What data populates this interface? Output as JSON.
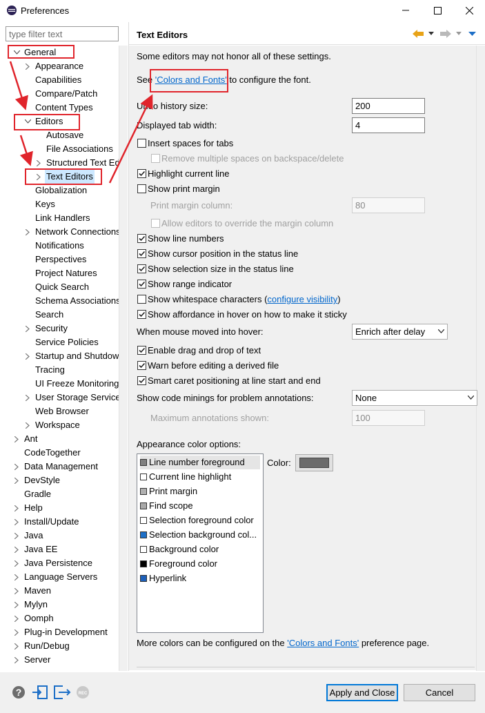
{
  "window": {
    "title": "Preferences"
  },
  "filter": {
    "placeholder": "type filter text"
  },
  "tree": {
    "items": [
      {
        "label": "General",
        "level": 0,
        "chevron": "down"
      },
      {
        "label": "Appearance",
        "level": 1,
        "chevron": "right"
      },
      {
        "label": "Capabilities",
        "level": 1,
        "chevron": ""
      },
      {
        "label": "Compare/Patch",
        "level": 1,
        "chevron": ""
      },
      {
        "label": "Content Types",
        "level": 1,
        "chevron": ""
      },
      {
        "label": "Editors",
        "level": 1,
        "chevron": "down"
      },
      {
        "label": "Autosave",
        "level": 2,
        "chevron": ""
      },
      {
        "label": "File Associations",
        "level": 2,
        "chevron": ""
      },
      {
        "label": "Structured Text Ed",
        "level": 2,
        "chevron": "right"
      },
      {
        "label": "Text Editors",
        "level": 2,
        "chevron": "right",
        "selected": true
      },
      {
        "label": "Globalization",
        "level": 1,
        "chevron": ""
      },
      {
        "label": "Keys",
        "level": 1,
        "chevron": ""
      },
      {
        "label": "Link Handlers",
        "level": 1,
        "chevron": ""
      },
      {
        "label": "Network Connections",
        "level": 1,
        "chevron": "right"
      },
      {
        "label": "Notifications",
        "level": 1,
        "chevron": ""
      },
      {
        "label": "Perspectives",
        "level": 1,
        "chevron": ""
      },
      {
        "label": "Project Natures",
        "level": 1,
        "chevron": ""
      },
      {
        "label": "Quick Search",
        "level": 1,
        "chevron": ""
      },
      {
        "label": "Schema Associations",
        "level": 1,
        "chevron": ""
      },
      {
        "label": "Search",
        "level": 1,
        "chevron": ""
      },
      {
        "label": "Security",
        "level": 1,
        "chevron": "right"
      },
      {
        "label": "Service Policies",
        "level": 1,
        "chevron": ""
      },
      {
        "label": "Startup and Shutdown",
        "level": 1,
        "chevron": "right"
      },
      {
        "label": "Tracing",
        "level": 1,
        "chevron": ""
      },
      {
        "label": "UI Freeze Monitoring",
        "level": 1,
        "chevron": ""
      },
      {
        "label": "User Storage Service",
        "level": 1,
        "chevron": "right"
      },
      {
        "label": "Web Browser",
        "level": 1,
        "chevron": ""
      },
      {
        "label": "Workspace",
        "level": 1,
        "chevron": "right"
      },
      {
        "label": "Ant",
        "level": 0,
        "chevron": "right"
      },
      {
        "label": "CodeTogether",
        "level": 0,
        "chevron": ""
      },
      {
        "label": "Data Management",
        "level": 0,
        "chevron": "right"
      },
      {
        "label": "DevStyle",
        "level": 0,
        "chevron": "right"
      },
      {
        "label": "Gradle",
        "level": 0,
        "chevron": ""
      },
      {
        "label": "Help",
        "level": 0,
        "chevron": "right"
      },
      {
        "label": "Install/Update",
        "level": 0,
        "chevron": "right"
      },
      {
        "label": "Java",
        "level": 0,
        "chevron": "right"
      },
      {
        "label": "Java EE",
        "level": 0,
        "chevron": "right"
      },
      {
        "label": "Java Persistence",
        "level": 0,
        "chevron": "right"
      },
      {
        "label": "Language Servers",
        "level": 0,
        "chevron": "right"
      },
      {
        "label": "Maven",
        "level": 0,
        "chevron": "right"
      },
      {
        "label": "Mylyn",
        "level": 0,
        "chevron": "right"
      },
      {
        "label": "Oomph",
        "level": 0,
        "chevron": "right"
      },
      {
        "label": "Plug-in Development",
        "level": 0,
        "chevron": "right"
      },
      {
        "label": "Run/Debug",
        "level": 0,
        "chevron": "right"
      },
      {
        "label": "Server",
        "level": 0,
        "chevron": "right"
      }
    ]
  },
  "page": {
    "title": "Text Editors",
    "intro": "Some editors may not honor all of these settings.",
    "see_prefix": "See ",
    "colors_fonts_link": "'Colors and Fonts'",
    "see_suffix": " to configure the font.",
    "undo_label": "Undo history size:",
    "undo_value": "200",
    "tab_width_label": "Displayed tab width:",
    "tab_width_value": "4",
    "insert_spaces": {
      "label": "Insert spaces for tabs",
      "checked": false
    },
    "remove_spaces": {
      "label": "Remove multiple spaces on backspace/delete",
      "checked": false,
      "disabled": true
    },
    "highlight_line": {
      "label": "Highlight current line",
      "checked": true
    },
    "show_print_margin": {
      "label": "Show print margin",
      "checked": false
    },
    "print_margin_col_label": "Print margin column:",
    "print_margin_col_value": "80",
    "allow_override": {
      "label": "Allow editors to override the margin column",
      "checked": false,
      "disabled": true
    },
    "show_line_numbers": {
      "label": "Show line numbers",
      "checked": true
    },
    "show_cursor_pos": {
      "label": "Show cursor position in the status line",
      "checked": true
    },
    "show_selection_size": {
      "label": "Show selection size in the status line",
      "checked": true
    },
    "show_range": {
      "label": "Show range indicator",
      "checked": true
    },
    "show_whitespace": {
      "label": "Show whitespace characters (",
      "link": "configure visibility",
      "suffix": ")",
      "checked": false
    },
    "show_affordance": {
      "label": "Show affordance in hover on how to make it sticky",
      "checked": true
    },
    "hover_label": "When mouse moved into hover:",
    "hover_value": "Enrich after delay",
    "drag_drop": {
      "label": "Enable drag and drop of text",
      "checked": true
    },
    "warn_derived": {
      "label": "Warn before editing a derived file",
      "checked": true
    },
    "smart_caret": {
      "label": "Smart caret positioning at line start and end",
      "checked": true
    },
    "code_minings_label": "Show code minings for problem annotations:",
    "code_minings_value": "None",
    "max_annotations_label": "Maximum annotations shown:",
    "max_annotations_value": "100",
    "appearance_label": "Appearance color options:",
    "color_label": "Color:",
    "color_options": [
      {
        "label": "Line number foreground",
        "color": "#808080",
        "selected": true
      },
      {
        "label": "Current line highlight",
        "color": "#ffffff"
      },
      {
        "label": "Print margin",
        "color": "#b0b0b0"
      },
      {
        "label": "Find scope",
        "color": "#a8a8a8"
      },
      {
        "label": "Selection foreground color",
        "color": "#ffffff"
      },
      {
        "label": "Selection background col...",
        "color": "#1d6fc7"
      },
      {
        "label": "Background color",
        "color": "#ffffff"
      },
      {
        "label": "Foreground color",
        "color": "#000000"
      },
      {
        "label": "Hyperlink",
        "color": "#1d5fb8"
      }
    ],
    "more_prefix": "More colors can be configured on the ",
    "more_link": "'Colors and Fonts'",
    "more_suffix": " preference page."
  },
  "buttons": {
    "apply_close": "Apply and Close",
    "cancel": "Cancel"
  },
  "colors": {
    "accent": "#0078d7",
    "annotation": "#e0242b",
    "nav_arrow": "#e8a317",
    "link": "#0066cc"
  }
}
